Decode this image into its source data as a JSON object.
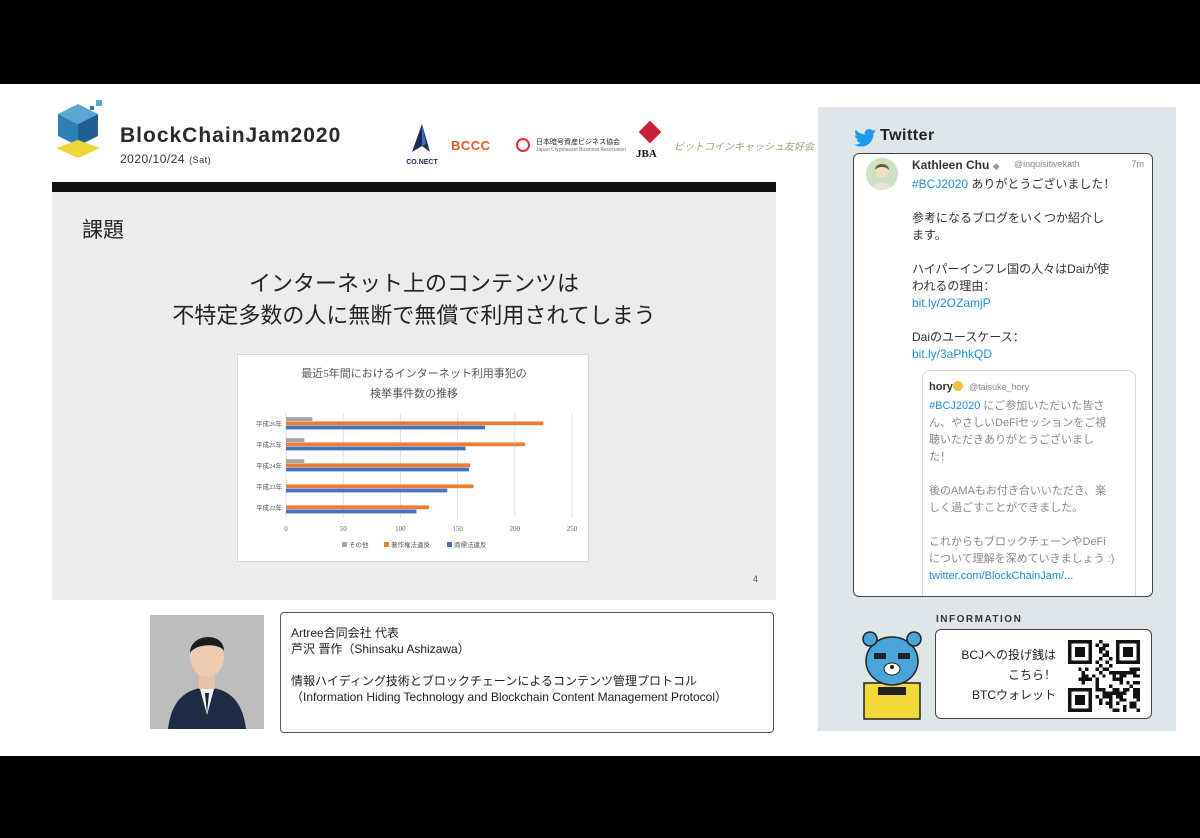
{
  "header": {
    "event_title": "BlockChainJam2020",
    "event_date": "2020/10/24",
    "event_dow": "(Sat)"
  },
  "sponsors": {
    "conect": "CO.NECT",
    "bcc": "BCCC",
    "jcba_line1": "日本暗号資産ビジネス協会",
    "jcba_line2": "Japan Cryptoasset Business Association",
    "jba": "JBA",
    "bitcoin": "ビットコインキャッシュ友好会"
  },
  "slide": {
    "heading": "課題",
    "line1": "インターネット上のコンテンツは",
    "line2": "不特定多数の人に無断で無償で利用されてしまう",
    "page_number": "4"
  },
  "chart_data": {
    "type": "bar",
    "orientation": "horizontal",
    "title_line1": "最近5年間におけるインターネット利用事犯の",
    "title_line2": "検挙事件数の推移",
    "categories": [
      "平成26年",
      "平成25年",
      "平成24年",
      "平成23年",
      "平成22年"
    ],
    "series": [
      {
        "name": "その他",
        "color": "#a5a5a5",
        "values": [
          23,
          16,
          16,
          0,
          0
        ]
      },
      {
        "name": "著作権法違反",
        "color": "#ed7d31",
        "values": [
          225,
          209,
          161,
          164,
          125
        ]
      },
      {
        "name": "商標法違反",
        "color": "#4472c4",
        "values": [
          174,
          157,
          160,
          141,
          114
        ]
      }
    ],
    "xlim": [
      0,
      250
    ],
    "xticks": [
      "0",
      "50",
      "100",
      "150",
      "200",
      "250"
    ],
    "legend_position": "bottom",
    "grid": true
  },
  "speaker": {
    "line1": "Artree合同会社 代表",
    "line2": "芦沢 晋作（Shinsaku Ashizawa）",
    "line3": "情報ハイディング技術とブロックチェーンによるコンテンツ管理プロトコル",
    "line4": "（Information Hiding Technology and Blockchain Content Management Protocol）"
  },
  "twitter": {
    "title": "Twitter",
    "tweet": {
      "name": "Kathleen Chu",
      "handle": "@inquisitivekath",
      "time": "7m",
      "hashtag": "#BCJ2020",
      "text1": " ありがとうございました！",
      "text2": "参考になるブログをいくつか紹介し",
      "text3": "ます。",
      "text4": "ハイパーインフレ国の人々はDaiが使",
      "text5": "われるの理由：",
      "link1": "bit.ly/2OZamjP",
      "text6": "Daiのユースケース：",
      "link2": "bit.ly/3aPhkQD"
    },
    "quote": {
      "name": "hory",
      "handle": "@taisuke_hory",
      "hashtag": "#BCJ2020",
      "text1": " にご参加いただいた皆さ",
      "text2": "ん、やさしいDeFiセッションをご視",
      "text3": "聴いただきありがとうございまし",
      "text4": "た！",
      "text5": "後のAMAもお付き合いいただき、楽",
      "text6": "しく過ごすことができました。",
      "text7": "これからもブロックチェーンやDeFi",
      "text8": "について理解を深めていきましょう :)",
      "link": "twitter.com/BlockChainJam/..."
    }
  },
  "information": {
    "label": "INFORMATION",
    "line1": "BCJへの投げ銭は",
    "line2": "こちら！",
    "line3": "BTCウォレット"
  }
}
